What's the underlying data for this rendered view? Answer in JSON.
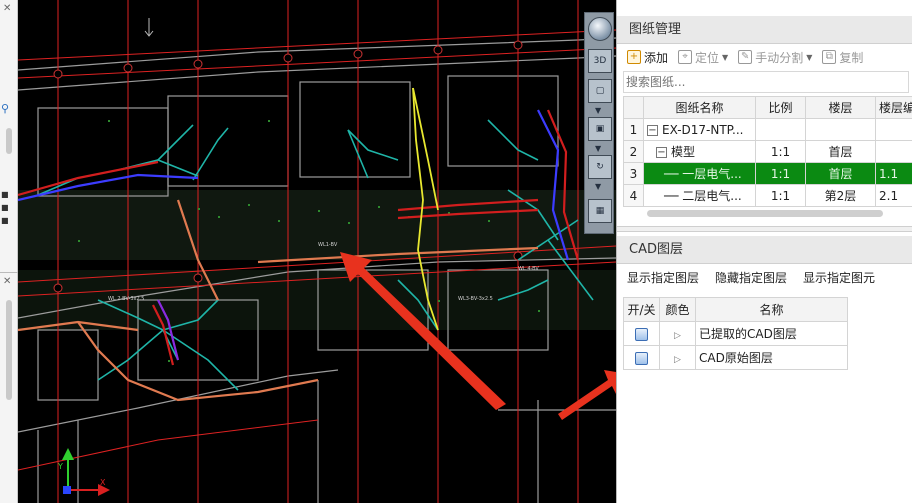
{
  "drawing_panel": {
    "title": "图纸管理",
    "toolbar": {
      "add": "添加",
      "locate": "定位",
      "manual_split": "手动分割",
      "copy": "复制"
    },
    "search_placeholder": "搜索图纸...",
    "columns": [
      "图纸名称",
      "比例",
      "楼层",
      "楼层编"
    ],
    "rows": [
      {
        "num": "1",
        "tree": "minus",
        "name": "EX-D17-NTP...",
        "scale": "",
        "floor": "",
        "code": "",
        "selected": false
      },
      {
        "num": "2",
        "tree": "minus",
        "name": "模型",
        "scale": "1:1",
        "floor": "首层",
        "code": "",
        "selected": false
      },
      {
        "num": "3",
        "tree": "",
        "name": "一层电气...",
        "scale": "1:1",
        "floor": "首层",
        "code": "1.1",
        "selected": true
      },
      {
        "num": "4",
        "tree": "",
        "name": "二层电气...",
        "scale": "1:1",
        "floor": "第2层",
        "code": "2.1",
        "selected": false
      }
    ]
  },
  "cad_layer_panel": {
    "title": "CAD图层",
    "actions": {
      "show_layer": "显示指定图层",
      "hide_layer": "隐藏指定图层",
      "show_element": "显示指定图元"
    },
    "columns": [
      "开/关",
      "颜色",
      "名称"
    ],
    "rows": [
      {
        "name": "已提取的CAD图层"
      },
      {
        "name": "CAD原始图层"
      }
    ]
  },
  "viewport_tools": {
    "view_3d": "3D",
    "axis_y": "Y",
    "axis_x": "X"
  },
  "colors": {
    "selected_row": "#0b8a12",
    "cad_background": "#000000",
    "annotation_arrow": "#e8321e"
  }
}
